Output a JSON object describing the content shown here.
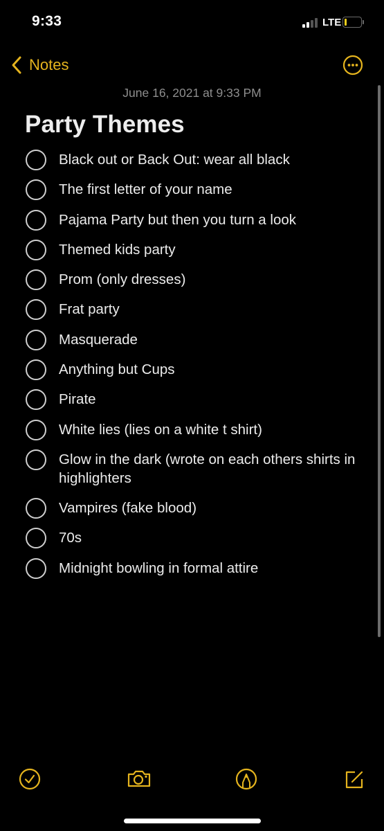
{
  "status_bar": {
    "time": "9:33",
    "network": "LTE",
    "signal_bars_active": 2,
    "signal_bars_total": 4,
    "battery_level_percent": 10,
    "battery_color": "#f2cf1d"
  },
  "colors": {
    "accent": "#e5b41e",
    "background": "#000000",
    "text": "#ececec",
    "secondary_text": "#8e8e8e"
  },
  "nav": {
    "back_label": "Notes",
    "back_icon": "chevron-left-icon",
    "more_icon": "ellipsis-circle-icon"
  },
  "note": {
    "date": "June 16, 2021 at 9:33 PM",
    "title": "Party Themes",
    "checklist": [
      {
        "text": "Black out or Back Out: wear all black",
        "checked": false
      },
      {
        "text": "The first letter of your name",
        "checked": false
      },
      {
        "text": "Pajama Party but then you turn a look",
        "checked": false
      },
      {
        "text": "Themed kids party",
        "checked": false
      },
      {
        "text": "Prom (only dresses)",
        "checked": false
      },
      {
        "text": "Frat party",
        "checked": false
      },
      {
        "text": "Masquerade",
        "checked": false
      },
      {
        "text": "Anything but Cups",
        "checked": false
      },
      {
        "text": "Pirate",
        "checked": false
      },
      {
        "text": "White lies (lies on a white t shirt)",
        "checked": false
      },
      {
        "text": "Glow in the dark (wrote on each others shirts in highlighters",
        "checked": false
      },
      {
        "text": "Vampires (fake blood)",
        "checked": false
      },
      {
        "text": "70s",
        "checked": false
      },
      {
        "text": "Midnight bowling in formal attire",
        "checked": false
      }
    ]
  },
  "toolbar": {
    "items": [
      {
        "name": "checklist",
        "icon": "checkmark-circle-icon"
      },
      {
        "name": "camera",
        "icon": "camera-icon"
      },
      {
        "name": "markup",
        "icon": "pen-tip-circle-icon"
      },
      {
        "name": "compose",
        "icon": "compose-icon"
      }
    ]
  }
}
